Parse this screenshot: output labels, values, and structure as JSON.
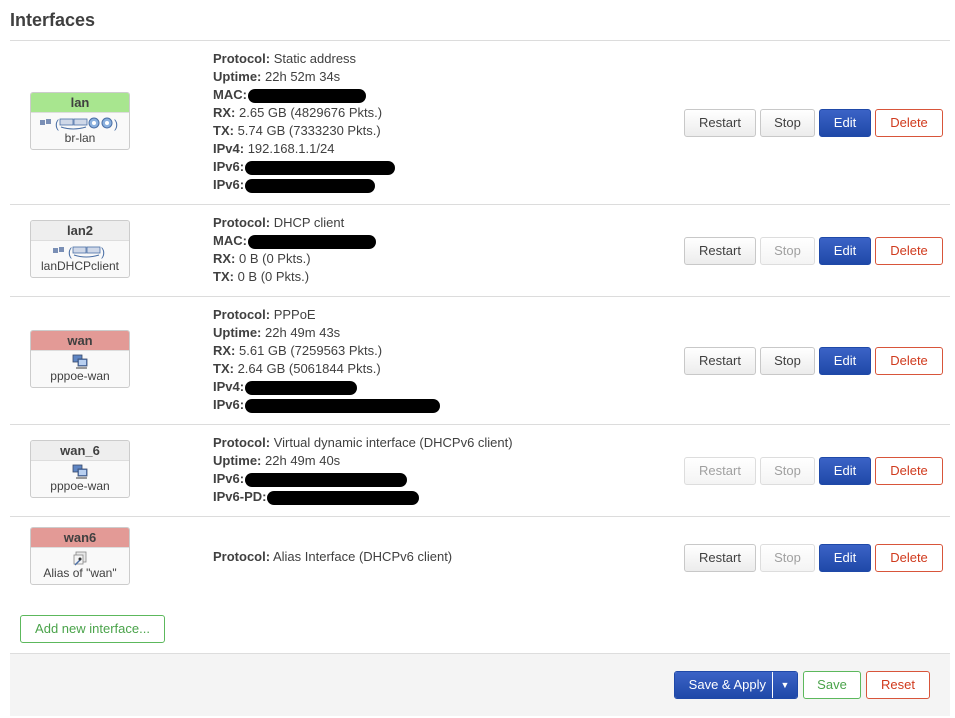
{
  "page": {
    "title": "Interfaces"
  },
  "interfaces": [
    {
      "name": "lan",
      "header_color": "#a8e68f",
      "device": "br-lan",
      "icons": [
        "ethernet-icon",
        "bridge-open-paren",
        "ethernet-switch-icon",
        "ethernet-switch-icon",
        "wifi-icon",
        "wifi-icon",
        "bridge-close-paren"
      ],
      "info": [
        {
          "label": "Protocol:",
          "value": "Static address"
        },
        {
          "label": "Uptime:",
          "value": "22h 52m 34s"
        },
        {
          "label": "MAC:",
          "value": "",
          "redacted": true
        },
        {
          "label": "RX:",
          "value": "2.65 GB (4829676 Pkts.)"
        },
        {
          "label": "TX:",
          "value": "5.74 GB (7333230 Pkts.)"
        },
        {
          "label": "IPv4:",
          "value": "192.168.1.1/24"
        },
        {
          "label": "IPv6:",
          "value": "",
          "redacted": true
        },
        {
          "label": "IPv6:",
          "value": "",
          "redacted": true
        }
      ],
      "buttons": {
        "restart": "Restart",
        "stop": "Stop",
        "edit": "Edit",
        "delete": "Delete"
      },
      "restart_disabled": false,
      "stop_disabled": false
    },
    {
      "name": "lan2",
      "header_color": "#eeeeee",
      "device": "lanDHCPclient",
      "info": [
        {
          "label": "Protocol:",
          "value": "DHCP client"
        },
        {
          "label": "MAC:",
          "value": "",
          "redacted": true
        },
        {
          "label": "RX:",
          "value": "0 B (0 Pkts.)"
        },
        {
          "label": "TX:",
          "value": "0 B (0 Pkts.)"
        }
      ],
      "buttons": {
        "restart": "Restart",
        "stop": "Stop",
        "edit": "Edit",
        "delete": "Delete"
      },
      "restart_disabled": false,
      "stop_disabled": true
    },
    {
      "name": "wan",
      "header_color": "#e39a96",
      "device": "pppoe-wan",
      "info": [
        {
          "label": "Protocol:",
          "value": "PPPoE"
        },
        {
          "label": "Uptime:",
          "value": "22h 49m 43s"
        },
        {
          "label": "RX:",
          "value": "5.61 GB (7259563 Pkts.)"
        },
        {
          "label": "TX:",
          "value": "2.64 GB (5061844 Pkts.)"
        },
        {
          "label": "IPv4:",
          "value": "",
          "redacted": true
        },
        {
          "label": "IPv6:",
          "value": "",
          "redacted": true
        }
      ],
      "buttons": {
        "restart": "Restart",
        "stop": "Stop",
        "edit": "Edit",
        "delete": "Delete"
      },
      "restart_disabled": false,
      "stop_disabled": false
    },
    {
      "name": "wan_6",
      "header_color": "#eeeeee",
      "device": "pppoe-wan",
      "info": [
        {
          "label": "Protocol:",
          "value": "Virtual dynamic interface (DHCPv6 client)"
        },
        {
          "label": "Uptime:",
          "value": "22h 49m 40s"
        },
        {
          "label": "IPv6:",
          "value": "",
          "redacted": true
        },
        {
          "label": "IPv6-PD:",
          "value": "",
          "redacted": true
        }
      ],
      "buttons": {
        "restart": "Restart",
        "stop": "Stop",
        "edit": "Edit",
        "delete": "Delete"
      },
      "restart_disabled": true,
      "stop_disabled": true
    },
    {
      "name": "wan6",
      "header_color": "#e39a96",
      "device": "Alias of \"wan\"",
      "info": [
        {
          "label": "Protocol:",
          "value": "Alias Interface (DHCPv6 client)"
        }
      ],
      "buttons": {
        "restart": "Restart",
        "stop": "Stop",
        "edit": "Edit",
        "delete": "Delete"
      },
      "restart_disabled": false,
      "stop_disabled": true
    }
  ],
  "add_interface_label": "Add new interface...",
  "footer": {
    "save_apply_label": "Save & Apply",
    "save_label": "Save",
    "reset_label": "Reset"
  },
  "colors": {
    "primary": "#1f49a8",
    "negative": "#d03a1d",
    "positive": "#5cb85c",
    "up_badge": "#a8e68f",
    "down_badge": "#e39a96"
  }
}
